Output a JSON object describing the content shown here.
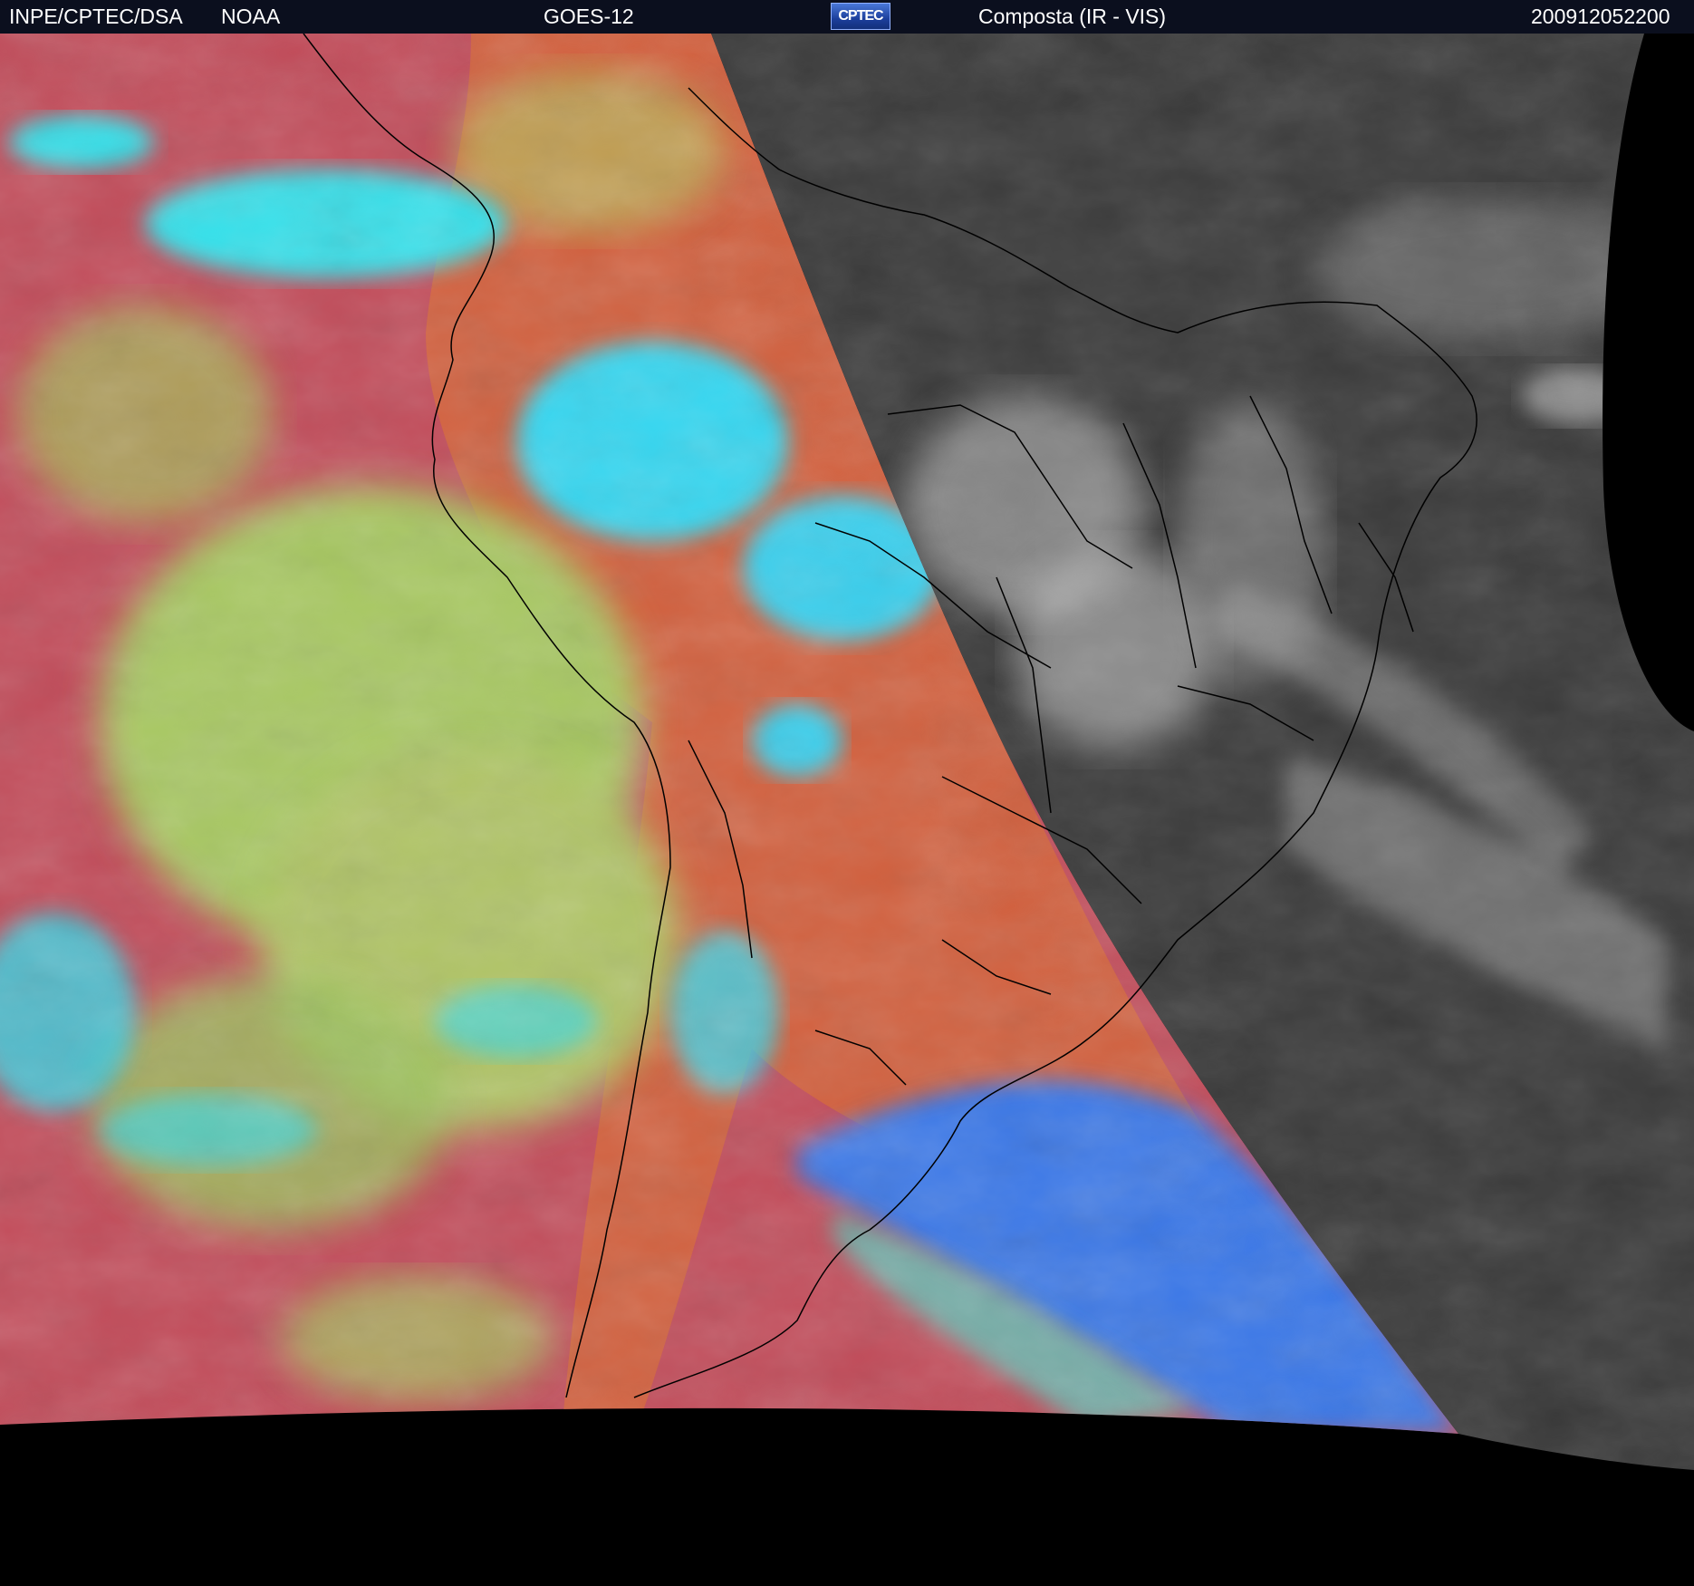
{
  "header": {
    "institution": "INPE/CPTEC/DSA",
    "agency": "NOAA",
    "satellite": "GOES-12",
    "logo_text": "CPTEC",
    "product": "Composta (IR - VIS)",
    "timestamp": "200912052200"
  },
  "colors": {
    "header_background": "#0b0f1e",
    "header_text": "#ffffff",
    "night_ir_base": "#c24c5a",
    "night_low_cloud": "#a8c862",
    "night_high_cloud": "#35e0ea",
    "night_cold_cloud": "#3a78e8",
    "day_visible_base": "#3a3a3a",
    "day_cloud": "#d8d8d8",
    "space": "#000000",
    "borders": "#000000"
  }
}
